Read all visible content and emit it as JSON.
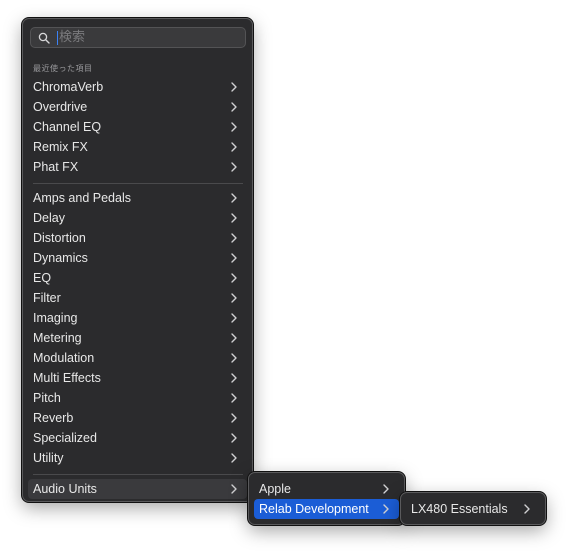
{
  "search": {
    "placeholder": "検索"
  },
  "recent": {
    "label": "最近使った項目",
    "items": [
      "ChromaVerb",
      "Overdrive",
      "Channel EQ",
      "Remix FX",
      "Phat FX"
    ]
  },
  "categories": [
    "Amps and Pedals",
    "Delay",
    "Distortion",
    "Dynamics",
    "EQ",
    "Filter",
    "Imaging",
    "Metering",
    "Modulation",
    "Multi Effects",
    "Pitch",
    "Reverb",
    "Specialized",
    "Utility"
  ],
  "audio_units": {
    "label": "Audio Units"
  },
  "submenu1": {
    "items": [
      "Apple",
      "Relab Development"
    ],
    "selected": "Relab Development"
  },
  "submenu2": {
    "items": [
      "LX480 Essentials"
    ]
  },
  "colors": {
    "menu_bg": "#2b2b2d",
    "selected": "#1b5dd6",
    "text": "#e8e8e8"
  },
  "icons": {
    "search": "magnifier-icon",
    "chevron": "chevron-right-icon"
  }
}
